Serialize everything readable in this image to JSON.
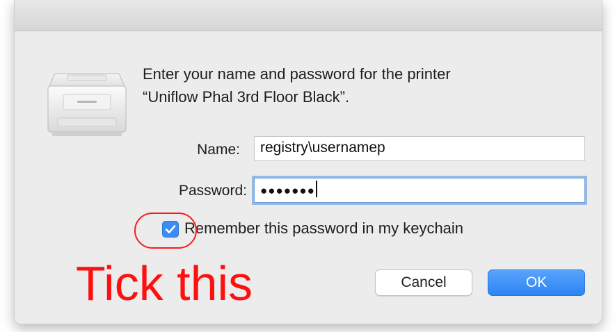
{
  "dialog": {
    "message_line1": "Enter your name and password for the printer",
    "message_line2": "“Uniflow Phal 3rd Floor Black”.",
    "name_label": "Name:",
    "name_value": "registry\\usernamep",
    "password_label": "Password:",
    "password_masked": "●●●●●●●",
    "remember_label": "Remember this password in my keychain",
    "remember_checked": true,
    "cancel_label": "Cancel",
    "ok_label": "OK",
    "icon": "printer-icon"
  },
  "annotation": {
    "text": "Tick this",
    "color": "#ff1010"
  },
  "colors": {
    "accent": "#3b8cf5",
    "dialog_bg": "#ececec"
  }
}
